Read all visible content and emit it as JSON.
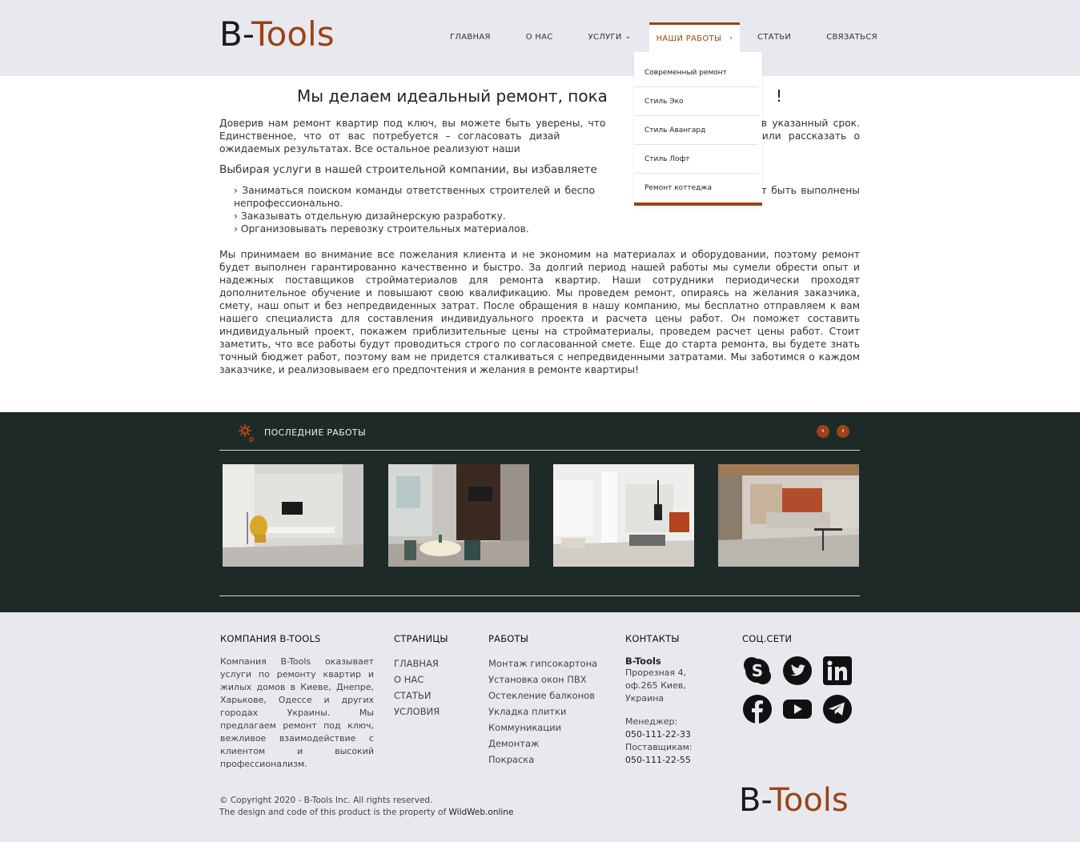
{
  "brand": {
    "part1": "B-",
    "part2": "Tools"
  },
  "nav": {
    "items": [
      {
        "label": "ГЛАВНАЯ"
      },
      {
        "label": "О НАС"
      },
      {
        "label": "УСЛУГИ"
      },
      {
        "label": "НАШИ РАБОТЫ"
      },
      {
        "label": "СТАТЬИ"
      },
      {
        "label": "СВЯЗАТЬСЯ"
      }
    ]
  },
  "dropdown": {
    "items": [
      "Современный ремонт",
      "Стиль Эко",
      "Стиль Авангард",
      "Стиль Лофт",
      "Ремонт коттеджа"
    ]
  },
  "main": {
    "headline": "Мы делаем идеальный ремонт, пока",
    "headline_tail": "!",
    "p1": "Доверив нам ремонт квартир под ключ, вы можете быть уверены, что",
    "p1_tail": "нены в указанный срок. Единственное, что от вас потребуется – согласовать дизай",
    "p1_tail2": "менеджером, или рассказать о ожидаемых результатах. Все остальное реализуют наши",
    "p2": "Выбирая услуги в нашей строительной компании, вы избавляете",
    "list": [
      "› Заниматься поиском команды ответственных строителей и беспо",
      "ты могут быть выполнены непрофессионально.",
      "› Заказывать отдельную дизайнерскую разработку.",
      "› Организовывать перевозку строительных материалов."
    ],
    "p3": "Мы принимаем во внимание все пожелания клиента и не экономим на материалах и оборудовании, поэтому ремонт будет выполнен гарантированно качественно и быстро. За долгий период нашей работы мы сумели обрести опыт и надежных поставщиков стройматериалов для ремонта квартир. Наши сотрудники периодически проходят дополнительное обучение и повышают свою квалификацию. Мы проведем ремонт, опираясь на желания заказчика, смету, наш опыт и без непредвиденных затрат. После обращения в нашу компанию, мы бесплатно отправляем к вам нашего специалиста для составления индивидуального проекта и расчета цены работ. Он поможет составить индивидуальный проект, покажем приблизительные цены на стройматериалы, проведем расчет цены работ. Стоит заметить, что все работы будут проводиться строго по согласованной смете. Еще до старта ремонта, вы будете знать точный бюджет работ, поэтому вам не придется сталкиваться с непредвиденными затратами. Мы заботимся о каждом заказчике, и реализовываем его предпочтения и желания в ремонте квартиры!"
  },
  "works": {
    "title": "ПОСЛЕДНИЕ РАБОТЫ",
    "prev": "‹",
    "next": "›"
  },
  "footer": {
    "company": {
      "heading": "КОМПАНИЯ B-TOOLS",
      "text": "Компания B-Tools оказывает услуги по ремонту квартир и жилых домов в Киеве, Днепре, Харькове, Одессе и других городах Украины. Мы предлагаем ремонт под ключ, вежливое взаимодействие с клиентом и высокий профессионализм."
    },
    "pages": {
      "heading": "СТРАНИЦЫ",
      "links": [
        "ГЛАВНАЯ",
        "О НАС",
        "СТАТЬИ",
        "УСЛОВИЯ"
      ]
    },
    "works": {
      "heading": "РАБОТЫ",
      "links": [
        "Монтаж гипсокартона",
        "Установка окон ПВХ",
        "Остекление балконов",
        "Укладка плитки",
        "Коммуникации",
        "Демонтаж",
        "Покраска"
      ]
    },
    "contacts": {
      "heading": "КОНТАКТЫ",
      "name": "B-Tools",
      "address1": "Прорезная 4,",
      "address2": "оф.265 Киев,",
      "address3": "Украина",
      "manager_label": "Менеджер:",
      "manager_phone": "050-111-22-33",
      "supplier_label": "Поставщикам:",
      "supplier_phone": "050-111-22-55"
    },
    "social": {
      "heading": "СОЦ.СЕТИ",
      "icons": [
        "skype-icon",
        "twitter-icon",
        "linkedin-icon",
        "facebook-icon",
        "youtube-icon",
        "telegram-icon"
      ]
    },
    "copyright_line1": "© Copyright 2020 - B-Tools Inc. All rights reserved.",
    "copyright_line2": "The design and code of this product is the property of",
    "copyright_link": "WildWeb.online"
  },
  "colors": {
    "accent": "#9a4418",
    "dark": "#1e2a27",
    "header_bg": "#e8e9ee"
  }
}
